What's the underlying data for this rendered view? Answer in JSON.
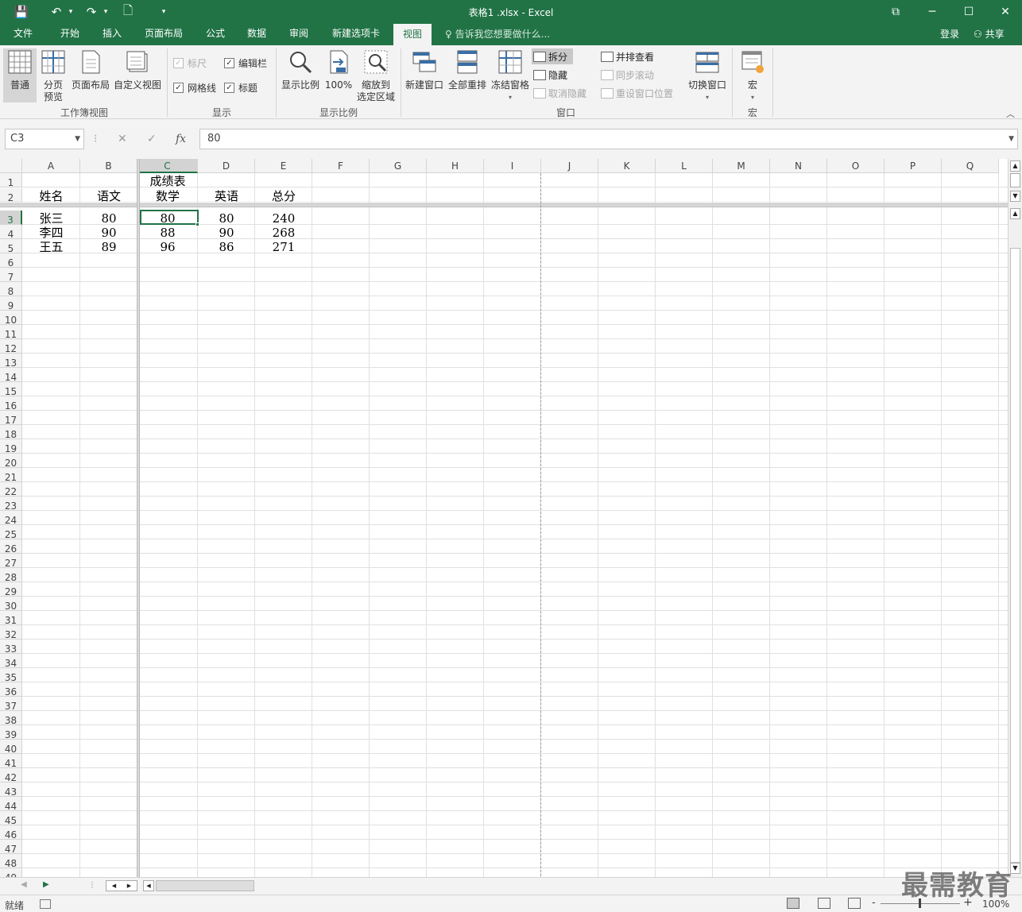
{
  "window": {
    "title": "表格1 .xlsx - Excel",
    "min": "─",
    "max": "☐",
    "close": "✕",
    "restore": "⧉"
  },
  "qat": {
    "save": "💾",
    "undo": "↶",
    "redo": "↷",
    "new": "🗋",
    "more": "▾"
  },
  "tabs": [
    "文件",
    "开始",
    "插入",
    "页面布局",
    "公式",
    "数据",
    "审阅",
    "新建选项卡",
    "视图"
  ],
  "active_tab": "视图",
  "tell_me": "告诉我您想要做什么...",
  "account": {
    "login": "登录",
    "share": "共享"
  },
  "ribbon": {
    "workbook_views": {
      "label": "工作簿视图",
      "normal": "普通",
      "page_break_1": "分页",
      "page_break_2": "预览",
      "page_layout": "页面布局",
      "custom": "自定义视图"
    },
    "show": {
      "label": "显示",
      "ruler": "标尺",
      "formula_bar": "编辑栏",
      "gridlines": "网格线",
      "headings": "标题",
      "ruler_checked": true,
      "formula_bar_checked": true,
      "gridlines_checked": true,
      "headings_checked": true,
      "check": "✓"
    },
    "zoom": {
      "label": "显示比例",
      "zoom": "显示比例",
      "hundred": "100%",
      "to_sel_1": "缩放到",
      "to_sel_2": "选定区域"
    },
    "window": {
      "label": "窗口",
      "new_window": "新建窗口",
      "arrange_all": "全部重排",
      "freeze": "冻结窗格",
      "split": "拆分",
      "hide": "隐藏",
      "unhide": "取消隐藏",
      "side_by_side": "并排查看",
      "sync_scroll": "同步滚动",
      "reset_pos": "重设窗口位置",
      "switch": "切换窗口"
    },
    "macros": {
      "label": "宏",
      "macro": "宏"
    }
  },
  "formula_bar": {
    "name_box": "C3",
    "value": "80",
    "fx": "fx",
    "cancel": "✕",
    "enter": "✓"
  },
  "columns": [
    "A",
    "B",
    "C",
    "D",
    "E",
    "F",
    "G",
    "H",
    "I",
    "J",
    "K",
    "L",
    "M",
    "N",
    "O",
    "P",
    "Q"
  ],
  "selected_col": "C",
  "selected_row": 3,
  "cells": [
    {
      "id": "C1",
      "text": "成绩表"
    },
    {
      "id": "A2",
      "text": "姓名"
    },
    {
      "id": "B2",
      "text": "语文"
    },
    {
      "id": "C2",
      "text": "数学"
    },
    {
      "id": "D2",
      "text": "英语"
    },
    {
      "id": "E2",
      "text": "总分"
    },
    {
      "id": "A3",
      "text": "张三"
    },
    {
      "id": "B3",
      "text": "80"
    },
    {
      "id": "C3",
      "text": "80"
    },
    {
      "id": "D3",
      "text": "80"
    },
    {
      "id": "E3",
      "text": "240"
    },
    {
      "id": "A4",
      "text": "李四"
    },
    {
      "id": "B4",
      "text": "90"
    },
    {
      "id": "C4",
      "text": "88"
    },
    {
      "id": "D4",
      "text": "90"
    },
    {
      "id": "E4",
      "text": "268"
    },
    {
      "id": "A5",
      "text": "王五"
    },
    {
      "id": "B5",
      "text": "89"
    },
    {
      "id": "C5",
      "text": "96"
    },
    {
      "id": "D5",
      "text": "86"
    },
    {
      "id": "E5",
      "text": "271"
    }
  ],
  "status": {
    "ready": "就绪",
    "zoom": "100%",
    "minus": "-",
    "plus": "+"
  },
  "watermark": "最需教育"
}
